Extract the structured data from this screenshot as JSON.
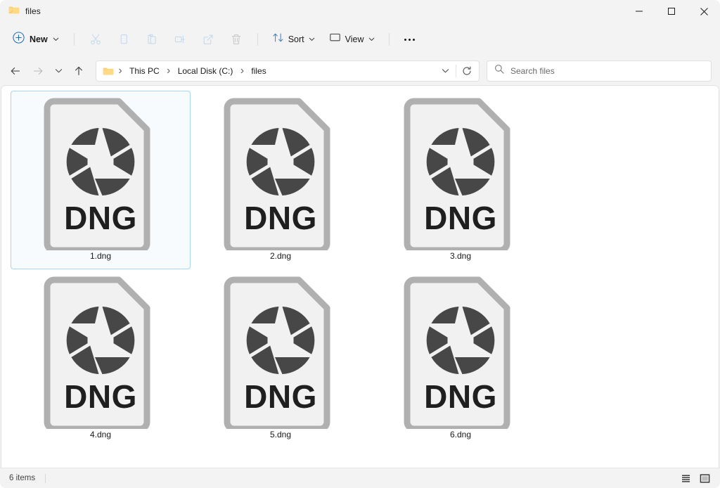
{
  "window": {
    "title": "files",
    "folder_icon": "folder-icon",
    "controls": {
      "minimize": "minimize-icon",
      "maximize": "maximize-icon",
      "close": "close-icon"
    }
  },
  "toolbar": {
    "new_label": "New",
    "new_icon": "plus-circle-icon",
    "new_chevron": "chevron-down-icon",
    "actions": [
      {
        "name": "cut-button",
        "icon": "scissors-icon",
        "enabled": false
      },
      {
        "name": "copy-button",
        "icon": "copy-icon",
        "enabled": false
      },
      {
        "name": "paste-button",
        "icon": "clipboard-icon",
        "enabled": false
      },
      {
        "name": "rename-button",
        "icon": "rename-icon",
        "enabled": false
      },
      {
        "name": "share-button",
        "icon": "share-icon",
        "enabled": false
      },
      {
        "name": "delete-button",
        "icon": "trash-icon",
        "enabled": false
      }
    ],
    "sort_label": "Sort",
    "sort_icon": "sort-arrows-icon",
    "view_label": "View",
    "view_icon": "view-monitor-icon",
    "more_label": "See more",
    "more_icon": "ellipsis-icon"
  },
  "navigation": {
    "back_icon": "arrow-left-icon",
    "forward_icon": "arrow-right-icon",
    "recent_icon": "chevron-down-icon",
    "up_icon": "arrow-up-icon",
    "breadcrumb_icon": "folder-icon",
    "breadcrumb": [
      "This PC",
      "Local Disk (C:)",
      "files"
    ],
    "breadcrumb_separator": "›",
    "breadcrumb_dropdown_icon": "chevron-down-icon",
    "refresh_icon": "refresh-icon"
  },
  "search": {
    "placeholder": "Search files",
    "icon": "search-icon",
    "value": ""
  },
  "files": [
    {
      "name": "1.dng",
      "type": "DNG",
      "selected": true
    },
    {
      "name": "2.dng",
      "type": "DNG",
      "selected": false
    },
    {
      "name": "3.dng",
      "type": "DNG",
      "selected": false
    },
    {
      "name": "4.dng",
      "type": "DNG",
      "selected": false
    },
    {
      "name": "5.dng",
      "type": "DNG",
      "selected": false
    },
    {
      "name": "6.dng",
      "type": "DNG",
      "selected": false
    }
  ],
  "statusbar": {
    "item_count": "6 items",
    "details_view_icon": "details-view-icon",
    "icons_view_icon": "large-icons-view-icon"
  },
  "colors": {
    "accent": "#0078d4",
    "chrome": "#f3f3f3",
    "content": "#ffffff",
    "selection_border": "#a8d5f2",
    "selection_fill": "#f7fbfe",
    "icon_doc_fill": "#f1f1f1",
    "icon_doc_stroke": "#b0b0b0",
    "icon_aperture": "#474747",
    "icon_text": "#1f1f1f",
    "disabled_icon": "#c6c6c6",
    "text": "#1a1a1a"
  }
}
